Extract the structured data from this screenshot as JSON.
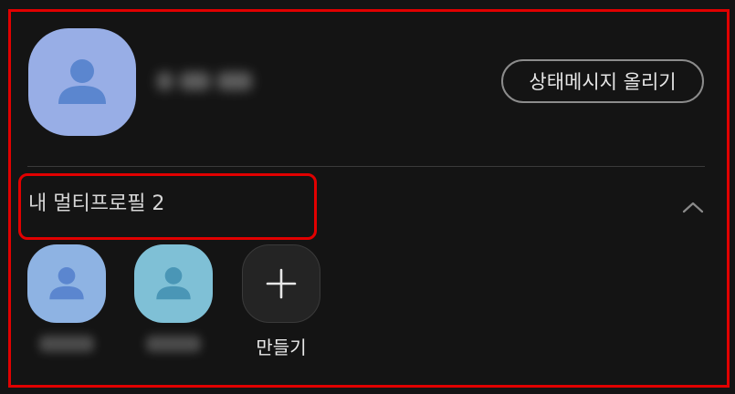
{
  "profile": {
    "status_button_label": "상태메시지 올리기"
  },
  "multi_profile": {
    "title": "내 멀티프로필 2",
    "items": [
      {
        "thumb_color": "#8eb3e3"
      },
      {
        "thumb_color": "#7fc0d6"
      }
    ],
    "create_label": "만들기"
  },
  "icons": {
    "avatar": "person-icon",
    "collapse": "chevron-up-icon",
    "create": "plus-icon"
  },
  "colors": {
    "highlight_border": "#e10000",
    "background": "#141414",
    "large_avatar": "#98aee6",
    "person_glyph": "#5b86cf"
  }
}
